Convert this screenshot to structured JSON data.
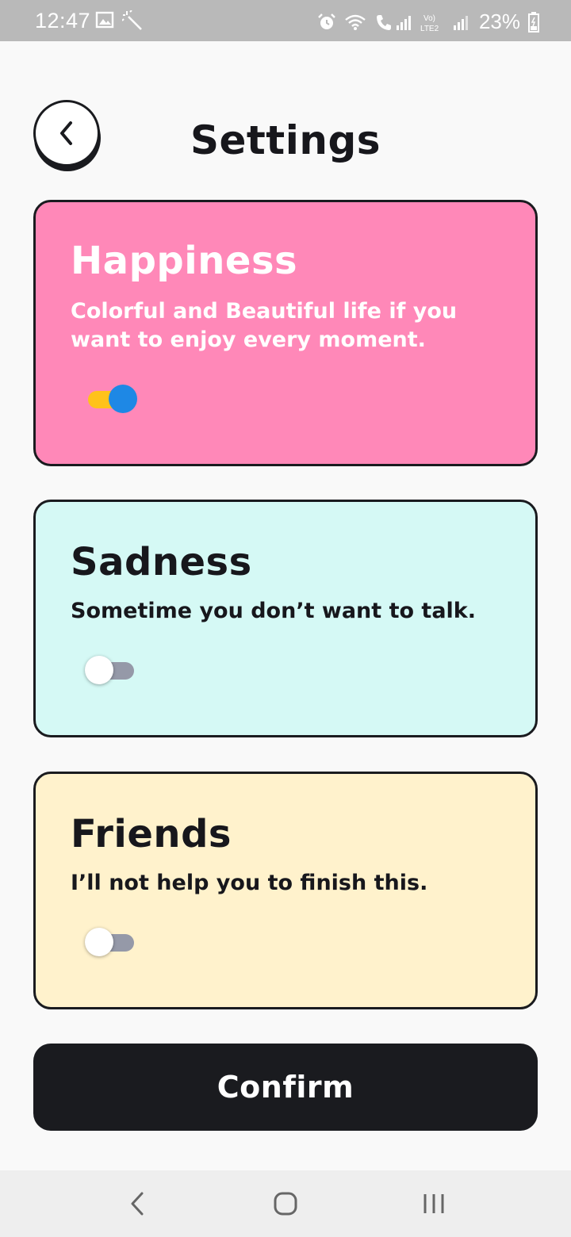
{
  "status_bar": {
    "time": "12:47",
    "battery": "23%",
    "icons": [
      "image-icon",
      "magic-wand-icon",
      "alarm-icon",
      "wifi-icon",
      "wifi-call-icon",
      "signal-icon",
      "volte-icon",
      "signal-icon",
      "battery-icon"
    ]
  },
  "header": {
    "title": "Settings",
    "back_icon": "chevron-left-icon"
  },
  "cards": [
    {
      "id": "happiness",
      "title": "Happiness",
      "description": "Colorful and Beautiful life if you want to enjoy every moment.",
      "enabled": true,
      "background": "#ff88b8"
    },
    {
      "id": "sadness",
      "title": "Sadness",
      "description": "Sometime you don’t want to talk.",
      "enabled": false,
      "background": "#d5f9f5"
    },
    {
      "id": "friends",
      "title": "Friends",
      "description": "I’ll not help you to finish this.",
      "enabled": false,
      "background": "#fff2cc"
    }
  ],
  "confirm": {
    "label": "Confirm"
  },
  "nav_bar": {
    "icons": [
      "back-icon",
      "home-icon",
      "recents-icon"
    ]
  },
  "colors": {
    "accent_dark": "#1a1b1f",
    "toggle_on_track": "#ffc21a",
    "toggle_on_knob": "#1e88e5",
    "toggle_off_track": "#9599a8"
  }
}
